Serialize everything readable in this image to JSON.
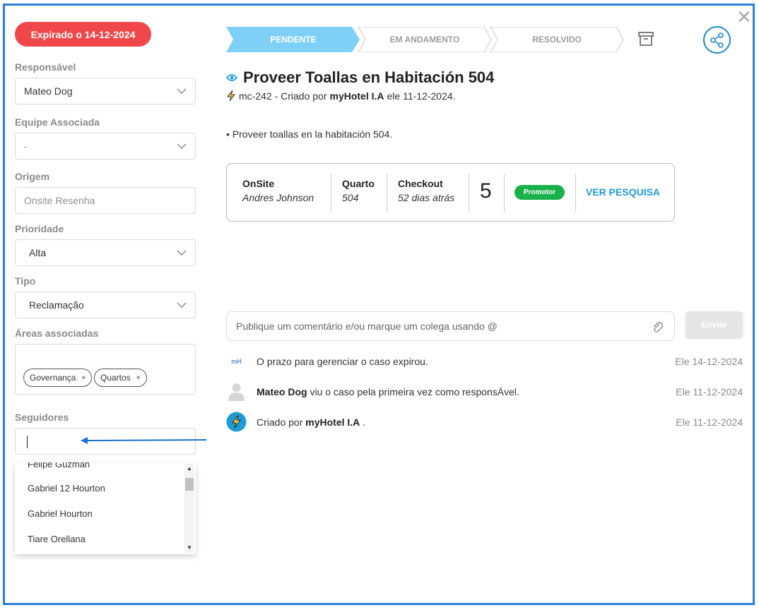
{
  "close_label": "✕",
  "badge": "Expirado o 14-12-2024",
  "form": {
    "responsavel": {
      "label": "Responsável",
      "value": "Mateo Dog"
    },
    "equipe": {
      "label": "Equipe Associada",
      "value": "-"
    },
    "origem": {
      "label": "Origem",
      "placeholder": "Onsite Resenha"
    },
    "prioridade": {
      "label": "Prioridade",
      "value": "Alta"
    },
    "tipo": {
      "label": "Tipo",
      "value": "Reclamação"
    },
    "areas": {
      "label": "Áreas associadas",
      "tags": [
        "Governança",
        "Quartos"
      ],
      "remove": "×"
    },
    "seguidores": {
      "label": "Seguidores",
      "options": [
        "Felipe Guzman",
        "Gabriel 12 Hourton",
        "Gabriel Hourton",
        "Tiare Orellana"
      ]
    }
  },
  "steps": [
    "PENDENTE",
    "EM ANDAMENTO",
    "RESOLVIDO"
  ],
  "header": {
    "title": "Proveer Toallas en Habitación 504",
    "code": "mc-242 - Criado por",
    "author": "myHotel I.A",
    "date_text": "ele 11-12-2024."
  },
  "description": "• Proveer toallas en la habitación 504.",
  "card": {
    "onsite": {
      "label": "OnSite",
      "value": "Andres Johnson"
    },
    "quarto": {
      "label": "Quarto",
      "value": "504"
    },
    "checkout": {
      "label": "Checkout",
      "value": "52 dias atrás"
    },
    "score": "5",
    "badge": "Promotor",
    "link": "VER PESQUISA"
  },
  "comment": {
    "placeholder": "Publique um comentário e/ou marque um colega usando @",
    "send": "Enviar"
  },
  "activity": [
    {
      "avatar": "mH",
      "text": "O prazo para gerenciar o caso expirou.",
      "date": "Ele 14-12-2024"
    },
    {
      "bold": "Mateo Dog",
      "text": " viu o caso pela primeira vez como responsÁvel.",
      "date": "Ele 11-12-2024"
    },
    {
      "prefix": "Criado por ",
      "bold": "myHotel I.A",
      "suffix": " .",
      "date": "Ele 11-12-2024"
    }
  ],
  "colors": {
    "accent": "#1e9bd7",
    "step_active": "#7fd0f7",
    "danger": "#f0474a",
    "success": "#19b14a"
  }
}
